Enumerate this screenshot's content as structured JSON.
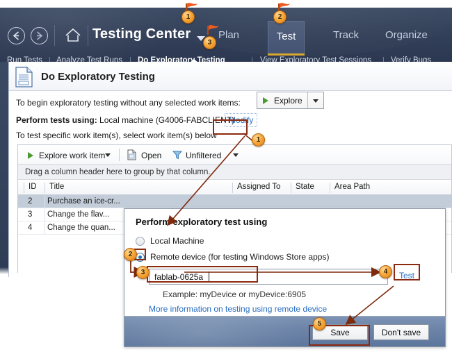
{
  "window": {
    "app_title": "Testing Center"
  },
  "nav": {
    "back_icon": "back-arrow-icon",
    "forward_icon": "forward-arrow-icon",
    "home_icon": "home-icon",
    "title_caret_icon": "chevron-down-icon",
    "main_tabs": [
      {
        "label": "Plan",
        "active": false
      },
      {
        "label": "Test",
        "active": true
      },
      {
        "label": "Track",
        "active": false
      },
      {
        "label": "Organize",
        "active": false
      }
    ],
    "sub_tabs": [
      {
        "label": "Run Tests",
        "active": false
      },
      {
        "label": "Analyze Test Runs",
        "active": false
      },
      {
        "label": "Do Exploratory Testing",
        "active": true
      },
      {
        "label": "View Exploratory Test Sessions",
        "active": false
      },
      {
        "label": "Verify Bugs",
        "active": false
      }
    ]
  },
  "page": {
    "icon": "document-icon",
    "title": "Do Exploratory Testing",
    "line1": "To begin exploratory testing without any selected work items:",
    "explore_button": {
      "label": "Explore",
      "play_icon": "play-icon",
      "caret_icon": "chevron-down-icon"
    },
    "perform_label": "Perform tests using:",
    "perform_value": "Local machine (G4006-FABCLIENT)",
    "modify_link": "Modify",
    "line3": "To test specific work item(s), select work item(s) below"
  },
  "grid": {
    "toolbar": {
      "explore_work_item": "Explore work item",
      "explore_play_icon": "play-icon",
      "explore_caret_icon": "chevron-down-icon",
      "open_label": "Open",
      "open_icon": "open-document-icon",
      "filter_label": "Unfiltered",
      "filter_icon": "funnel-icon",
      "filter_caret_icon": "chevron-down-icon"
    },
    "group_hint": "Drag a column header here to group by that column.",
    "columns": [
      "ID",
      "Title",
      "Assigned To",
      "State",
      "Area Path"
    ],
    "rows": [
      {
        "id": "2",
        "title": "Purchase an ice-cr...",
        "assigned_to": "",
        "state": "",
        "area_path": "",
        "selected": true
      },
      {
        "id": "3",
        "title": "Change the flav...",
        "assigned_to": "",
        "state": "",
        "area_path": "",
        "selected": false
      },
      {
        "id": "4",
        "title": "Change the quan...",
        "assigned_to": "",
        "state": "",
        "area_path": "",
        "selected": false
      }
    ]
  },
  "dialog": {
    "title": "Perform exploratory test using",
    "option_local": "Local Machine",
    "option_remote": "Remote device (for testing Windows Store apps)",
    "device_value": "fablab-0625a",
    "test_link": "Test",
    "example_text": "Example: myDevice or myDevice:6905",
    "more_info_link": "More information on testing using remote device",
    "save_label": "Save",
    "dontsave_label": "Don't save"
  },
  "callouts": [
    {
      "number": "1",
      "has_flag": true
    },
    {
      "number": "2",
      "has_flag": true
    },
    {
      "number": "3",
      "has_flag": true
    },
    {
      "number": "1",
      "has_flag": false
    },
    {
      "number": "2",
      "has_flag": false
    },
    {
      "number": "3",
      "has_flag": false
    },
    {
      "number": "4",
      "has_flag": false
    },
    {
      "number": "5",
      "has_flag": false
    }
  ],
  "colors": {
    "chrome": "#34415a",
    "accent_underline": "#d9a62a",
    "highlight_box": "#8c2a10",
    "callout": "#f6a93b",
    "link": "#2a6ec2",
    "play_green": "#4a9a2e"
  }
}
